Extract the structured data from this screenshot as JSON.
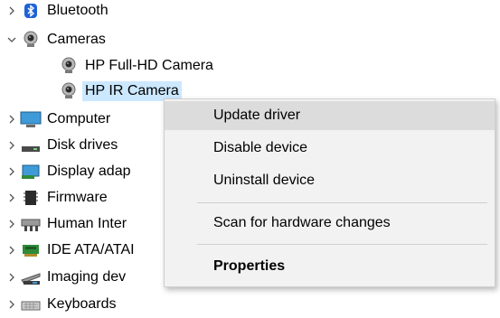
{
  "tree": {
    "items": [
      {
        "label": "Bluetooth",
        "icon": "bluetooth-icon"
      },
      {
        "label": "Cameras",
        "icon": "camera-icon"
      },
      {
        "label": "HP Full-HD Camera",
        "icon": "camera-icon"
      },
      {
        "label": "HP IR Camera",
        "icon": "camera-icon",
        "selected": true
      },
      {
        "label": "Computer",
        "icon": "monitor-icon"
      },
      {
        "label": "Disk drives",
        "icon": "disk-drive-icon"
      },
      {
        "label": "Display adap",
        "icon": "display-adapter-icon"
      },
      {
        "label": "Firmware",
        "icon": "firmware-chip-icon"
      },
      {
        "label": "Human Inter",
        "icon": "hid-icon"
      },
      {
        "label": "IDE ATA/ATAI",
        "icon": "ide-controller-icon"
      },
      {
        "label": "Imaging dev",
        "icon": "imaging-device-icon"
      },
      {
        "label": "Keyboards",
        "icon": "keyboard-icon"
      }
    ]
  },
  "context_menu": {
    "items": [
      {
        "label": "Update driver",
        "highlighted": true
      },
      {
        "label": "Disable device"
      },
      {
        "label": "Uninstall device"
      },
      {
        "label": "Scan for hardware changes"
      },
      {
        "label": "Properties",
        "bold": true
      }
    ]
  },
  "colors": {
    "selection": "#cce8ff",
    "menu_background": "#f2f2f2",
    "menu_highlight": "#dcdcdc"
  }
}
